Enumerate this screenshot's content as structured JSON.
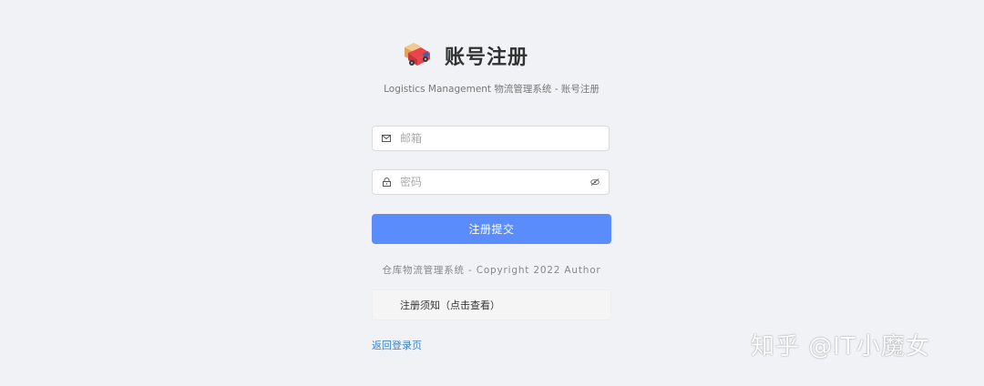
{
  "header": {
    "logo_icon": "delivery-truck-icon",
    "title": "账号注册",
    "subtitle": "Logistics Management 物流管理系统 - 账号注册"
  },
  "form": {
    "email": {
      "placeholder": "邮箱",
      "value": "",
      "prefix_icon": "mail-icon"
    },
    "password": {
      "placeholder": "密码",
      "value": "",
      "prefix_icon": "lock-icon",
      "suffix_icon": "eye-off-icon"
    },
    "submit_label": "注册提交"
  },
  "footer": {
    "copyright": "仓库物流管理系统 - Copyright 2022 Author",
    "notice_label": "注册须知（点击查看）",
    "back_link": "返回登录页"
  },
  "watermark": "知乎 @IT小魔女",
  "colors": {
    "background": "#f0f2f5",
    "primary": "#5b8cfb",
    "link": "#3b82c4"
  }
}
